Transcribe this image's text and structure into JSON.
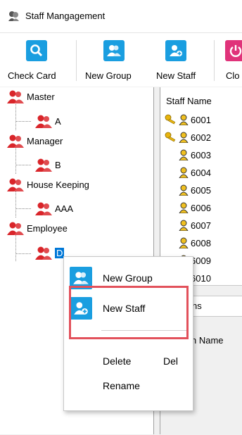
{
  "window": {
    "title": "Staff Mangagement"
  },
  "toolbar": {
    "buttons": [
      {
        "label": "Check Card",
        "icon": "search-icon",
        "color": "#1a9ee0"
      },
      {
        "label": "New Group",
        "icon": "add-group-icon",
        "color": "#1a9ee0"
      },
      {
        "label": "New Staff",
        "icon": "add-staff-icon",
        "color": "#1a9ee0"
      },
      {
        "label": "Clo",
        "icon": "power-icon",
        "color": "#e0337a"
      }
    ]
  },
  "tree": {
    "groups": [
      {
        "label": "Master",
        "child": "A"
      },
      {
        "label": "Manager",
        "child": "B"
      },
      {
        "label": "House Keeping",
        "child": "AAA"
      },
      {
        "label": "Employee",
        "child": "D"
      }
    ],
    "group_icon_color": "#d9252a"
  },
  "staff_list": {
    "header": "Staff Name",
    "rows": [
      {
        "name": "6001",
        "has_key": true
      },
      {
        "name": "6002",
        "has_key": true
      },
      {
        "name": "6003",
        "has_key": false
      },
      {
        "name": "6004",
        "has_key": false
      },
      {
        "name": "6005",
        "has_key": false
      },
      {
        "name": "6006",
        "has_key": false
      },
      {
        "name": "6007",
        "has_key": false
      },
      {
        "name": "6008",
        "has_key": false
      },
      {
        "name": "6009",
        "has_key": false
      },
      {
        "name": "6010",
        "has_key": false
      }
    ]
  },
  "lower_panel": {
    "tab_text": "ns",
    "column_text": "n Name"
  },
  "context_menu": {
    "items": [
      {
        "label": "New Group",
        "icon": "add-group-icon",
        "shortcut": ""
      },
      {
        "label": "New Staff",
        "icon": "add-staff-icon",
        "shortcut": ""
      },
      {
        "label": "Delete",
        "icon": "",
        "shortcut": "Del"
      },
      {
        "label": "Rename",
        "icon": "",
        "shortcut": ""
      }
    ]
  },
  "annotation": {
    "highlight_color": "#e2515b"
  }
}
